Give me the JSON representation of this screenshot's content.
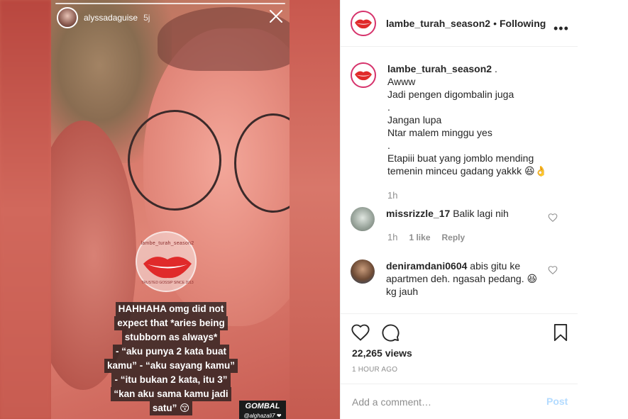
{
  "story": {
    "username": "alyssadaguise",
    "time": "5j",
    "caption_lines": [
      "HAHHAHA omg did not",
      "expect that *aries being",
      "stubborn as always*",
      "- “aku punya 2 kata buat",
      "kamu” - “aku sayang kamu”",
      "- “itu bukan 2 kata, itu 3”",
      "“kan aku sama kamu jadi",
      "satu” 😚"
    ],
    "tag": "GOMBAL",
    "tag_sub": "@alghazali7 ❤"
  },
  "watermark": {
    "top_text": "lambe_turah_season2",
    "bottom_text": "TRUSTED GOSSIP SINCE 2013"
  },
  "header": {
    "username": "lambe_turah_season2",
    "separator": "•",
    "follow_status": "Following",
    "more": "•••"
  },
  "post_caption": {
    "username": "lambe_turah_season2",
    "lines": [
      ".",
      "Awww",
      "Jadi pengen digombalin juga",
      ".",
      "Jangan lupa",
      "Ntar malem minggu yes",
      ".",
      "Etapiii buat yang jomblo mending",
      "temenin minceu gadang yakkk 😆👌"
    ],
    "time": "1h"
  },
  "comments": [
    {
      "username": "missrizzle_17",
      "text": "Balik lagi nih",
      "time": "1h",
      "likes": "1 like",
      "reply": "Reply"
    },
    {
      "username": "deniramdani0604",
      "text": "abis gitu ke apartmen deh. ngasah pedang. 😆 kg jauh"
    }
  ],
  "stats": {
    "views": "22,265 views",
    "posted": "1 HOUR AGO"
  },
  "add_comment": {
    "placeholder": "Add a comment…",
    "post_label": "Post"
  },
  "colors": {
    "ring": "#d6336c",
    "lips": "#e02a2a",
    "post_button": "#b3dbff",
    "muted": "#8e8e8e"
  }
}
